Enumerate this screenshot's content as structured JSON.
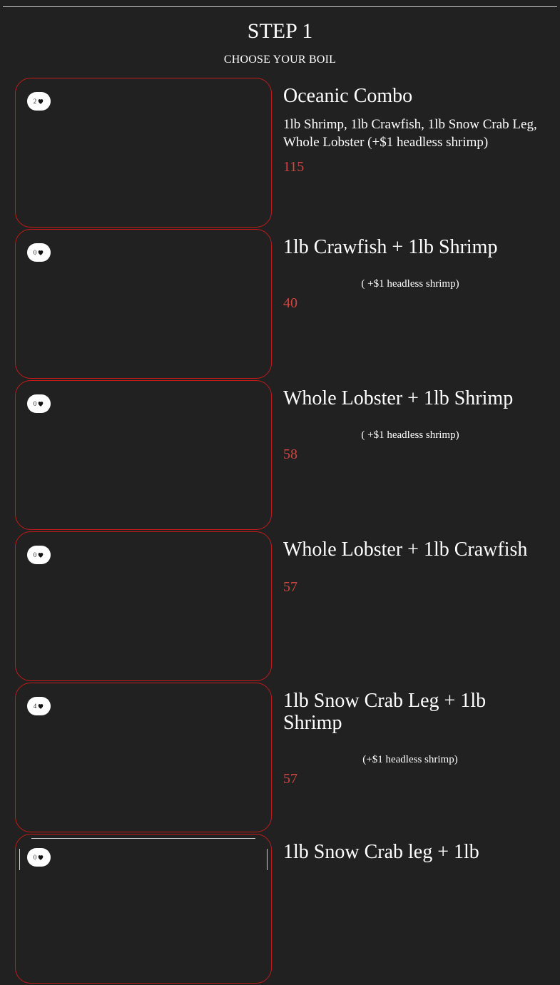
{
  "header": {
    "title": "STEP 1",
    "subtitle": "CHOOSE YOUR BOIL"
  },
  "colors": {
    "background": "#212121",
    "accent": "#c31a1a",
    "price": "#d0453f"
  },
  "items": [
    {
      "likes": "2",
      "name": "Oceanic Combo",
      "description": "1lb Shrimp, 1lb Crawfish, 1lb Snow Crab Leg, Whole Lobster (+$1 headless shrimp)",
      "note": "",
      "price": "115"
    },
    {
      "likes": "0",
      "name": "1lb Crawfish + 1lb Shrimp",
      "description": "",
      "note": "( +$1 headless shrimp)",
      "price": "40"
    },
    {
      "likes": "0",
      "name": "Whole Lobster + 1lb Shrimp",
      "description": "",
      "note": "( +$1 headless shrimp)",
      "price": "58"
    },
    {
      "likes": "0",
      "name": "Whole Lobster + 1lb Crawfish",
      "description": "",
      "note": "",
      "price": "57"
    },
    {
      "likes": "4",
      "name": "1lb Snow Crab Leg + 1lb Shrimp",
      "description": "",
      "note": "(+$1 headless shrimp)",
      "price": "57"
    },
    {
      "likes": "0",
      "name": "1lb Snow Crab leg + 1lb",
      "description": "",
      "note": "",
      "price": ""
    }
  ],
  "icons": {
    "like": "heart-icon"
  }
}
